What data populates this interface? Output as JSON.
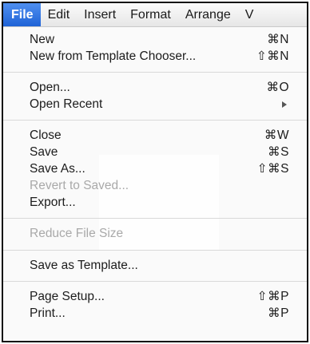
{
  "menubar": {
    "items": [
      {
        "label": "File",
        "active": true
      },
      {
        "label": "Edit"
      },
      {
        "label": "Insert"
      },
      {
        "label": "Format"
      },
      {
        "label": "Arrange"
      },
      {
        "label": "V"
      }
    ]
  },
  "menu": {
    "groups": [
      {
        "items": [
          {
            "label": "New",
            "shortcut": "⌘N"
          },
          {
            "label": "New from Template Chooser...",
            "shortcut": "⇧⌘N"
          }
        ]
      },
      {
        "items": [
          {
            "label": "Open...",
            "shortcut": "⌘O"
          },
          {
            "label": "Open Recent",
            "submenu": true
          }
        ]
      },
      {
        "items": [
          {
            "label": "Close",
            "shortcut": "⌘W"
          },
          {
            "label": "Save",
            "shortcut": "⌘S"
          },
          {
            "label": "Save As...",
            "shortcut": "⇧⌘S"
          },
          {
            "label": "Revert to Saved...",
            "disabled": true
          },
          {
            "label": "Export..."
          }
        ]
      },
      {
        "items": [
          {
            "label": "Reduce File Size",
            "disabled": true
          }
        ]
      },
      {
        "items": [
          {
            "label": "Save as Template..."
          }
        ]
      },
      {
        "items": [
          {
            "label": "Page Setup...",
            "shortcut": "⇧⌘P"
          },
          {
            "label": "Print...",
            "shortcut": "⌘P"
          }
        ]
      }
    ]
  }
}
